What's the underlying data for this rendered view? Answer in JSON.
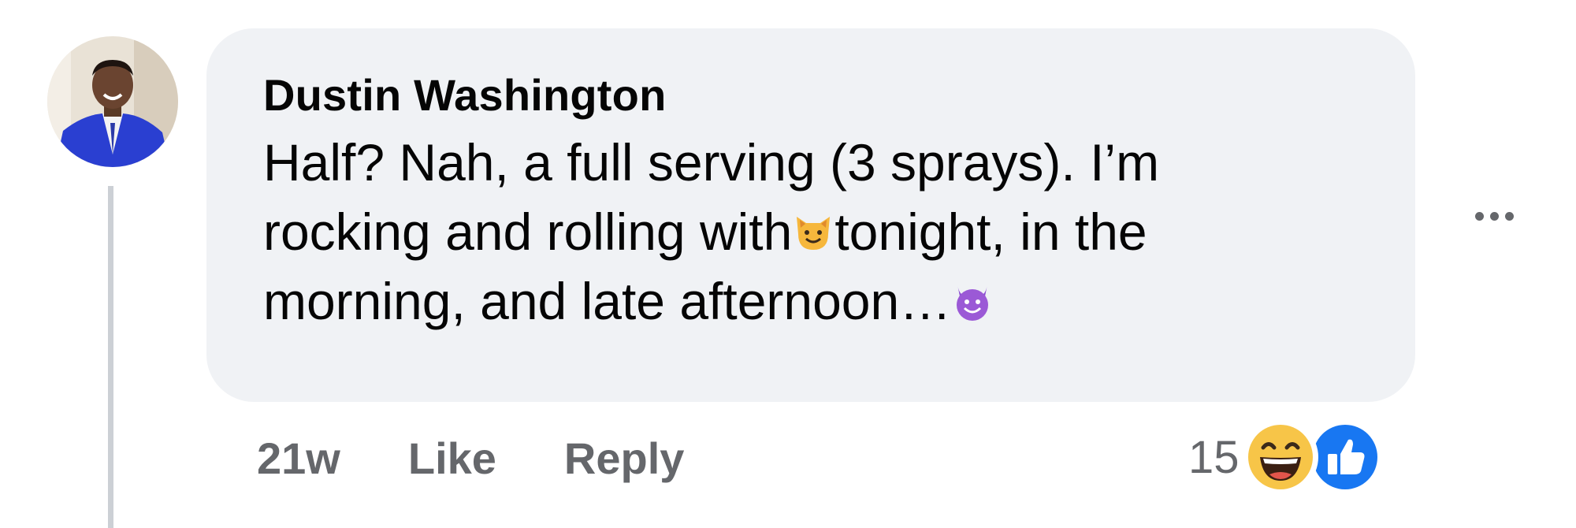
{
  "comment": {
    "author": "Dustin Washington",
    "text_parts": {
      "part1": "Half? Nah, a full serving (3 sprays). I’m rocking and rolling with",
      "part2": "tonight, in the morning, and late afternoon…"
    },
    "emojis": [
      "smiling-cat-emoji",
      "smiling-devil-emoji"
    ],
    "timestamp": "21w",
    "like_label": "Like",
    "reply_label": "Reply",
    "reaction_count": "15",
    "reaction_icons": [
      "haha-reaction-icon",
      "like-reaction-icon"
    ],
    "colors": {
      "bubble": "#f0f2f5",
      "text": "#050505",
      "secondary": "#65676b",
      "like_blue": "#1877f2",
      "avatar_suit": "#2a3fd1"
    }
  }
}
